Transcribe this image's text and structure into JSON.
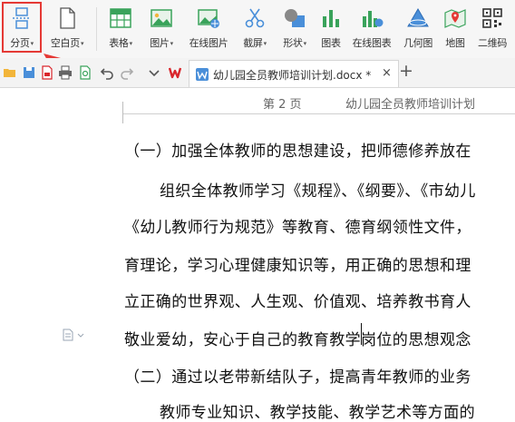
{
  "ribbon": {
    "items": [
      {
        "name": "page-break",
        "label": "分页",
        "dropdown": true,
        "icon": "page-break-icon"
      },
      {
        "name": "blank-page",
        "label": "空白页",
        "dropdown": true,
        "icon": "blank-page-icon"
      },
      {
        "name": "table",
        "label": "表格",
        "dropdown": true,
        "icon": "table-icon"
      },
      {
        "name": "picture",
        "label": "图片",
        "dropdown": true,
        "icon": "picture-icon"
      },
      {
        "name": "online-picture",
        "label": "在线图片",
        "dropdown": false,
        "icon": "online-picture-icon"
      },
      {
        "name": "screenshot",
        "label": "截屏",
        "dropdown": true,
        "icon": "scissors-icon"
      },
      {
        "name": "shape",
        "label": "形状",
        "dropdown": true,
        "icon": "shape-icon"
      },
      {
        "name": "chart",
        "label": "图表",
        "dropdown": false,
        "icon": "chart-icon"
      },
      {
        "name": "online-chart",
        "label": "在线图表",
        "dropdown": false,
        "icon": "online-chart-icon"
      },
      {
        "name": "geometry",
        "label": "几何图",
        "dropdown": false,
        "icon": "geometry-icon"
      },
      {
        "name": "map",
        "label": "地图",
        "dropdown": false,
        "icon": "map-icon"
      },
      {
        "name": "qrcode",
        "label": "二维码",
        "dropdown": false,
        "icon": "qrcode-icon"
      }
    ],
    "dropdown_glyph": "▾"
  },
  "tab": {
    "title": "幼儿园全员教师培训计划.docx *",
    "close_glyph": "×",
    "new_tab_glyph": "+"
  },
  "document": {
    "header_page": "第 2 页",
    "header_title": "幼儿园全员教师培训计划",
    "lines": [
      "（一）加强全体教师的思想建设，把师德修养放在",
      "组织全体教师学习《规程》、《纲要》、《市幼儿",
      "《幼儿教师行为规范》等教育、德育纲领性文件，",
      "育理论，学习心理健康知识等，用正确的思想和理",
      "立正确的世界观、人生观、价值观、培养教书育人",
      "敬业爱幼，安心于自己的教育教学岗位的思想观念",
      "（二）通过以老带新结队子，提高青年教师的业务",
      "教师专业知识、教学技能、教学艺术等方面的"
    ]
  },
  "colors": {
    "accent_red": "#e53935",
    "wps_red": "#d9262c",
    "ribbon_bg": "#f6f6f6",
    "icon_green": "#3aa35b",
    "icon_blue": "#4a8fd9"
  }
}
